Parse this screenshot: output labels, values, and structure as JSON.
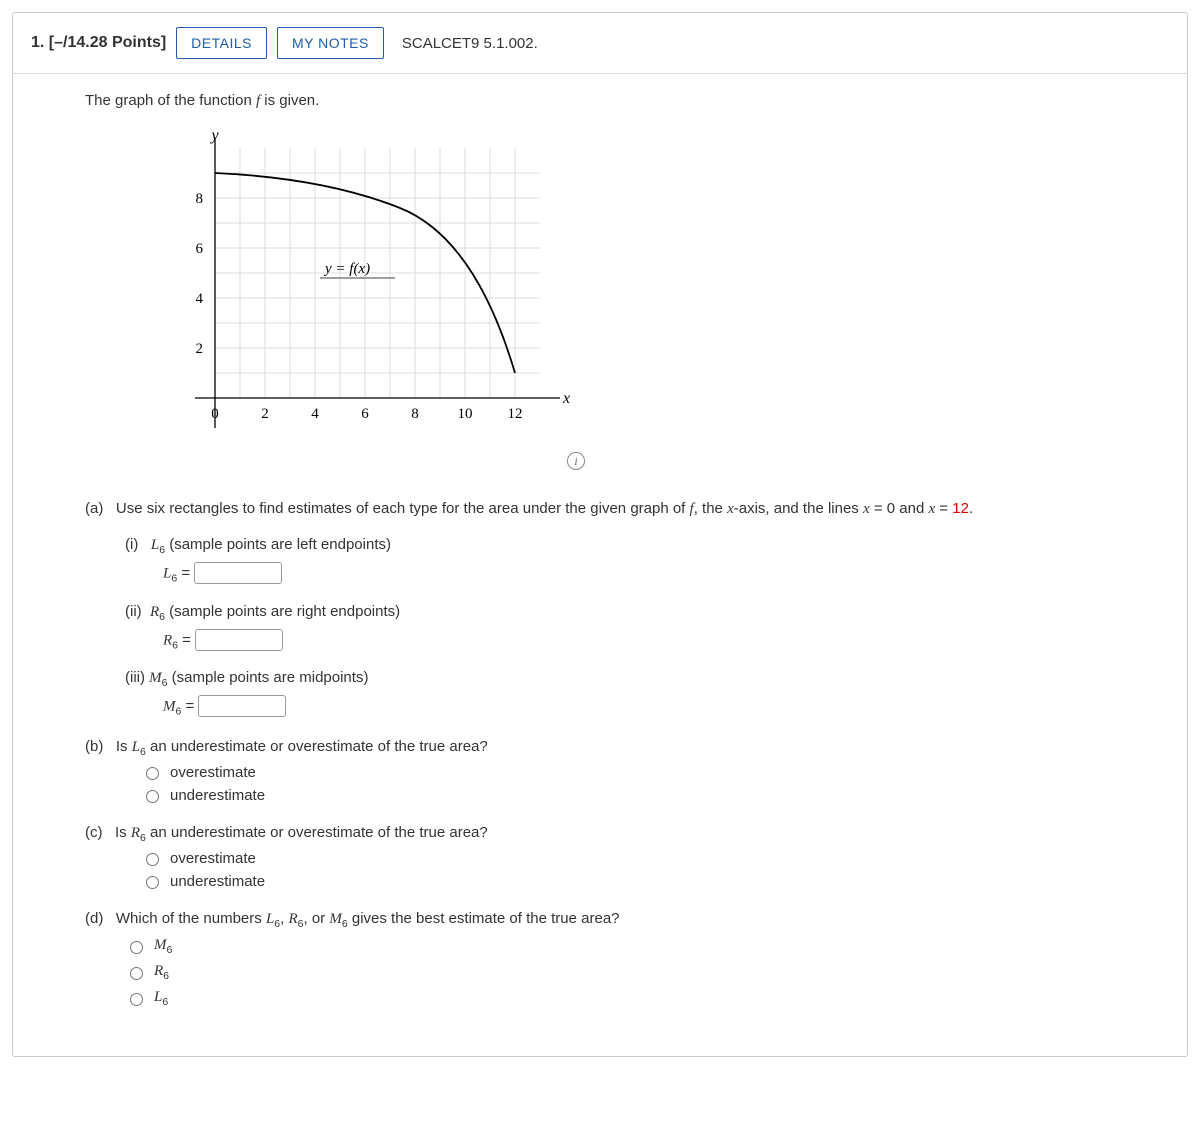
{
  "header": {
    "qnum": "1.",
    "points": "[–/14.28 Points]",
    "details_btn": "DETAILS",
    "notes_btn": "MY NOTES",
    "source": "SCALCET9 5.1.002."
  },
  "prompt_pre": "The graph of the function ",
  "prompt_fn": "f",
  "prompt_post": " is given.",
  "graph": {
    "ylabel": "y",
    "xlabel": "x",
    "curve_label": "y = f(x)",
    "xticks": [
      "0",
      "2",
      "4",
      "6",
      "8",
      "10",
      "12"
    ],
    "yticks": [
      "2",
      "4",
      "6",
      "8"
    ]
  },
  "a": {
    "label": "(a)",
    "text_pre": "Use six rectangles to find estimates of each type for the area under the given graph of ",
    "text_mid1": ", the ",
    "text_mid2": "-axis, and the lines ",
    "text_eq1": " = 0 and ",
    "text_eq2": " = ",
    "twelve": "12",
    "period": ".",
    "i": {
      "label": "(i)",
      "desc": " (sample points are left endpoints)",
      "sym": "L",
      "sub": "6",
      "eq": " = "
    },
    "ii": {
      "label": "(ii)",
      "desc": " (sample points are right endpoints)",
      "sym": "R",
      "sub": "6",
      "eq": " = "
    },
    "iii": {
      "label": "(iii)",
      "desc": " (sample points are midpoints)",
      "sym": "M",
      "sub": "6",
      "eq": " = "
    }
  },
  "b": {
    "label": "(b)",
    "pre": "Is ",
    "sym": "L",
    "sub": "6",
    "post": " an underestimate or overestimate of the true area?",
    "opt1": "overestimate",
    "opt2": "underestimate"
  },
  "c": {
    "label": "(c)",
    "pre": "Is ",
    "sym": "R",
    "sub": "6",
    "post": " an underestimate or overestimate of the true area?",
    "opt1": "overestimate",
    "opt2": "underestimate"
  },
  "d": {
    "label": "(d)",
    "pre": "Which of the numbers ",
    "s1": "L",
    "s2": "R",
    "s3": "M",
    "sub": "6",
    "comma": ", ",
    "or": " or ",
    "post": " gives the best estimate of the true area?",
    "opt1_sym": "M",
    "opt2_sym": "R",
    "opt3_sym": "L"
  },
  "chart_data": {
    "type": "line",
    "title": "",
    "xlabel": "x",
    "ylabel": "y",
    "xlim": [
      0,
      13
    ],
    "ylim": [
      0,
      9
    ],
    "series": [
      {
        "name": "y = f(x)",
        "x": [
          0,
          2,
          4,
          6,
          8,
          10,
          12
        ],
        "y": [
          9,
          8.8,
          8.4,
          7.6,
          6.4,
          4.6,
          1.0
        ]
      }
    ]
  }
}
